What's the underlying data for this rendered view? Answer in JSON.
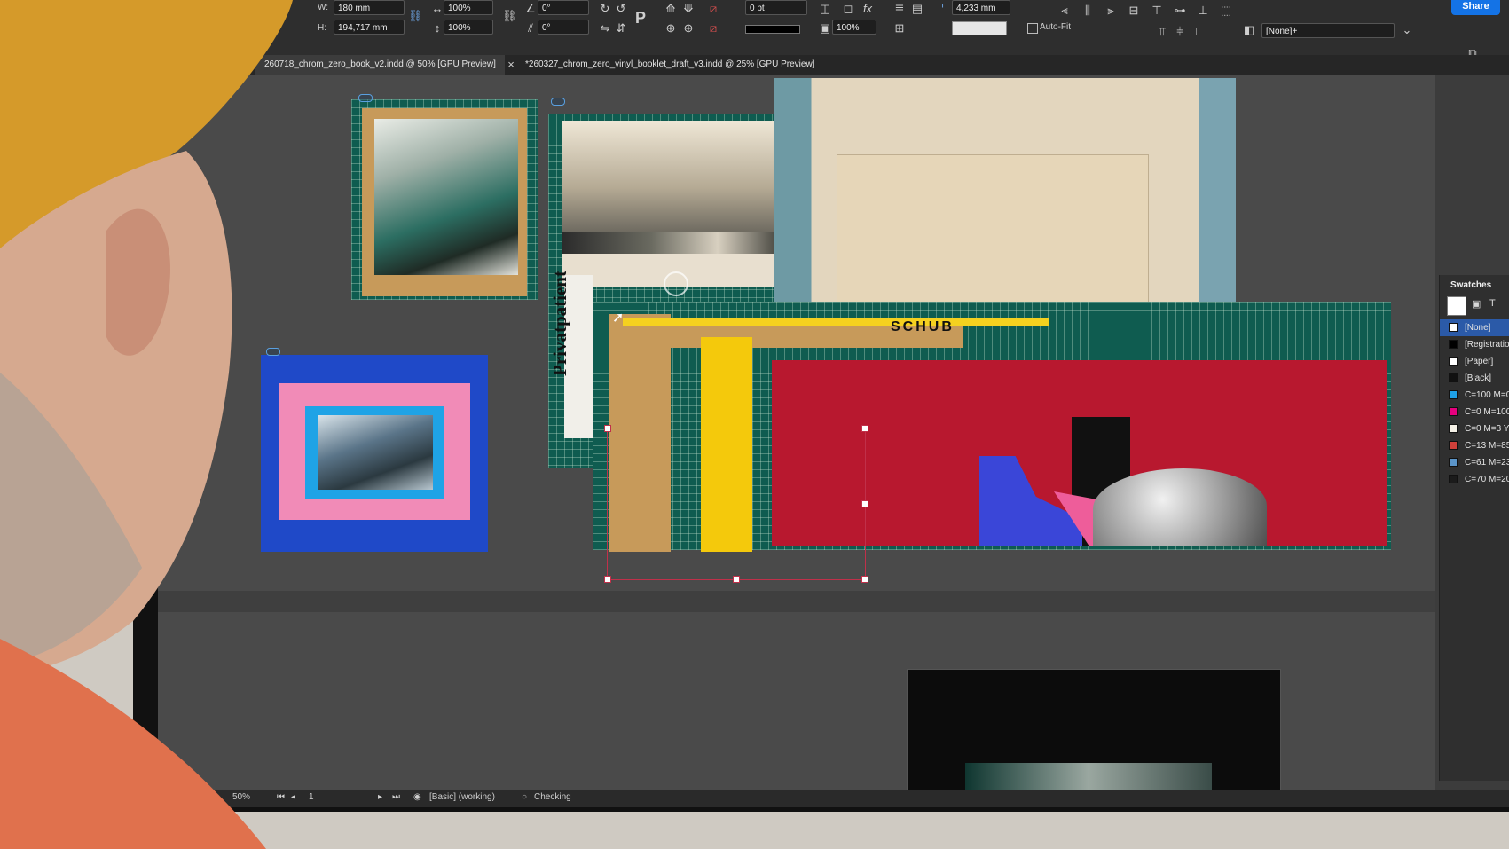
{
  "toolbar": {
    "w_label": "W:",
    "w_value": "180 mm",
    "h_label": "H:",
    "h_value": "194,717 mm",
    "x_prefix": "mm",
    "scale_x": "100%",
    "scale_y": "100%",
    "rotate": "0°",
    "shear": "0°",
    "stroke_weight": "0 pt",
    "opacity": "100%",
    "dimension": "4,233 mm",
    "autofit_label": "Auto-Fit",
    "style_select": "[None]+",
    "share_label": "Share"
  },
  "tabs": [
    {
      "label": "260718_chrom_zero_book_v2.indd @ 50% [GPU Preview]"
    },
    {
      "label": "*260327_chrom_zero_vinyl_booklet_draft_v3.indd @ 25% [GPU Preview]"
    }
  ],
  "canvas": {
    "privatpatient_text": "Privatpatient",
    "poster_text": "SCHUB"
  },
  "swatches": {
    "title": "Swatches",
    "items": [
      {
        "name": "[None]",
        "color": "#ffffff"
      },
      {
        "name": "[Registration]",
        "color": "#000000"
      },
      {
        "name": "[Paper]",
        "color": "#ffffff"
      },
      {
        "name": "[Black]",
        "color": "#111111"
      },
      {
        "name": "C=100 M=0",
        "color": "#1ea0e6"
      },
      {
        "name": "C=0 M=100",
        "color": "#e6007e"
      },
      {
        "name": "C=0 M=3 Y",
        "color": "#f4f0e6"
      },
      {
        "name": "C=13 M=85",
        "color": "#d0403a"
      },
      {
        "name": "C=61 M=23",
        "color": "#5b95c9"
      },
      {
        "name": "C=70 M=20",
        "color": "#1b1b1b"
      }
    ]
  },
  "status": {
    "zoom": "50%",
    "page": "1",
    "profile": "[Basic] (working)",
    "preflight": "Checking"
  }
}
